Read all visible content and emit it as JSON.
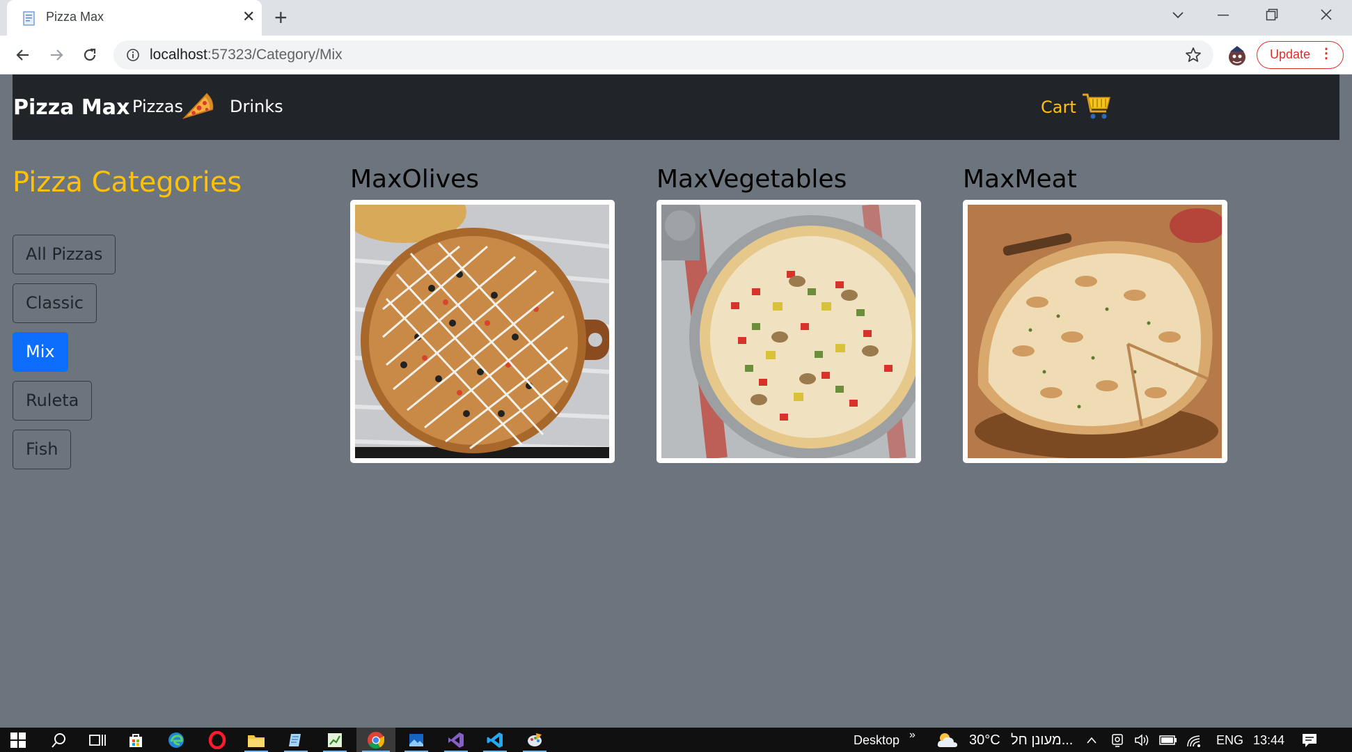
{
  "browser": {
    "tab_title": "Pizza Max",
    "tab_close": "✕",
    "new_tab": "+",
    "url_host": "localhost",
    "url_rest": ":57323/Category/Mix",
    "update_label": "Update",
    "update_menu": "⋮"
  },
  "navbar": {
    "brand": "Pizza Max",
    "pizzas": "Pizzas",
    "drinks": "Drinks",
    "cart": "Cart"
  },
  "sidebar": {
    "title": "Pizza Categories",
    "categories": [
      {
        "label": "All Pizzas",
        "active": false
      },
      {
        "label": "Classic",
        "active": false
      },
      {
        "label": "Mix",
        "active": true
      },
      {
        "label": "Ruleta",
        "active": false
      },
      {
        "label": "Fish",
        "active": false
      }
    ]
  },
  "products": [
    {
      "name": "MaxOlives"
    },
    {
      "name": "MaxVegetables"
    },
    {
      "name": "MaxMeat"
    }
  ],
  "taskbar": {
    "desktop": "Desktop",
    "chevron": "»",
    "temperature": "30°C",
    "weather": "מעונן חל...",
    "caret": "^",
    "language": "ENG",
    "time": "13:44"
  },
  "colors": {
    "page_bg": "#6c757d",
    "navbar_bg": "#212529",
    "accent_yellow": "#ffc107",
    "active_blue": "#0d6efd"
  }
}
